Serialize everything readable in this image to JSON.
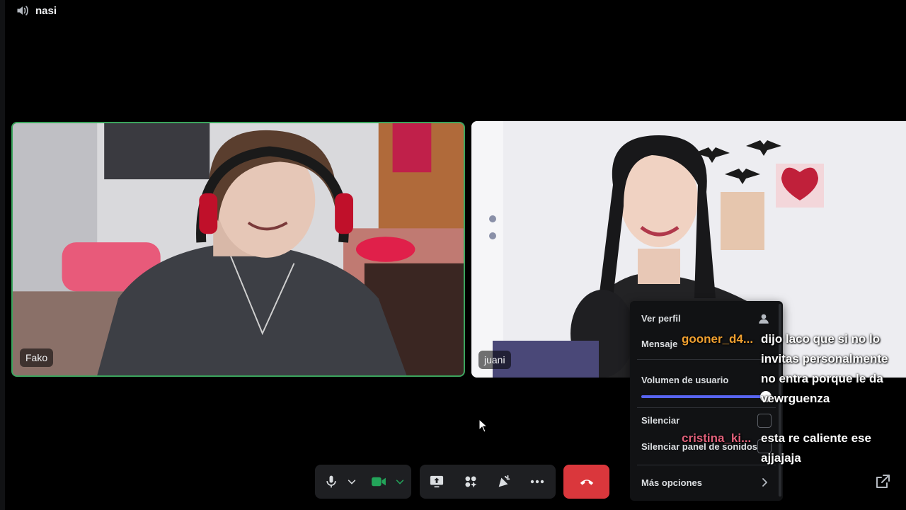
{
  "channel": {
    "name": "nasi"
  },
  "participants": [
    {
      "name": "Fako",
      "speaking": true
    },
    {
      "name": "juani",
      "speaking": false
    }
  ],
  "context_menu": {
    "view_profile": "Ver perfil",
    "message": "Mensaje",
    "user_volume": "Volumen de usuario",
    "user_volume_level": 1.0,
    "mute": "Silenciar",
    "mute_soundboard": "Silenciar panel de sonidos",
    "more_options": "Más opciones"
  },
  "chat_overlay": [
    {
      "user": "gooner_d4...",
      "user_color": "#f0a030",
      "text": "dijo laco que si no lo invitas personalmente no entra porque le da vewrguenza"
    },
    {
      "user": "cristina_ki...",
      "user_color": "#e0607a",
      "text": "esta re caliente ese ajjajaja"
    }
  ],
  "controls": {
    "icons": [
      "microphone-icon",
      "chevron-down-icon",
      "camera-icon",
      "chevron-down-icon",
      "screen-share-icon",
      "activities-icon",
      "soundboard-icon",
      "more-icon",
      "hang-up-icon",
      "popout-icon"
    ]
  },
  "colors": {
    "speaking_border": "#3ba55d",
    "slider": "#5865f2",
    "end_call": "#da373c",
    "camera_on": "#23a55a"
  }
}
